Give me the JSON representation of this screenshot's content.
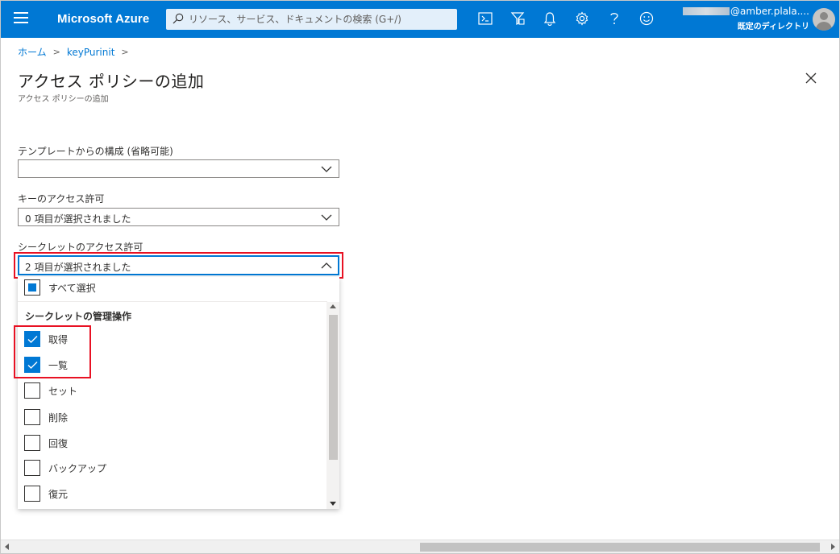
{
  "header": {
    "brand": "Microsoft Azure",
    "search_placeholder": "リソース、サービス、ドキュメントの検索 (G+/)",
    "account_user_suffix": "@amber.plala....",
    "account_directory": "既定のディレクトリ",
    "icons": [
      "cloud-shell-icon",
      "directory-filter-icon",
      "notifications-bell-icon",
      "settings-gear-icon",
      "help-icon",
      "feedback-smiley-icon"
    ],
    "colors": {
      "accent": "#0078d4"
    }
  },
  "breadcrumb": {
    "home": "ホーム",
    "current": "keyPurinit"
  },
  "page": {
    "title": "アクセス ポリシーの追加",
    "subtitle": "アクセス ポリシーの追加"
  },
  "form": {
    "template_label": "テンプレートからの構成 (省略可能)",
    "template_value": "",
    "key_label": "キーのアクセス許可",
    "key_value": "0 項目が選択されました",
    "secret_label": "シークレットのアクセス許可",
    "secret_value": "2 項目が選択されました"
  },
  "dropdown": {
    "select_all": "すべて選択",
    "group_label": "シークレットの管理操作",
    "items": [
      {
        "label": "取得",
        "checked": true
      },
      {
        "label": "一覧",
        "checked": true
      },
      {
        "label": "セット",
        "checked": false
      },
      {
        "label": "削除",
        "checked": false
      },
      {
        "label": "回復",
        "checked": false
      },
      {
        "label": "バックアップ",
        "checked": false
      },
      {
        "label": "復元",
        "checked": false
      }
    ]
  },
  "highlight_color": "#e81123"
}
